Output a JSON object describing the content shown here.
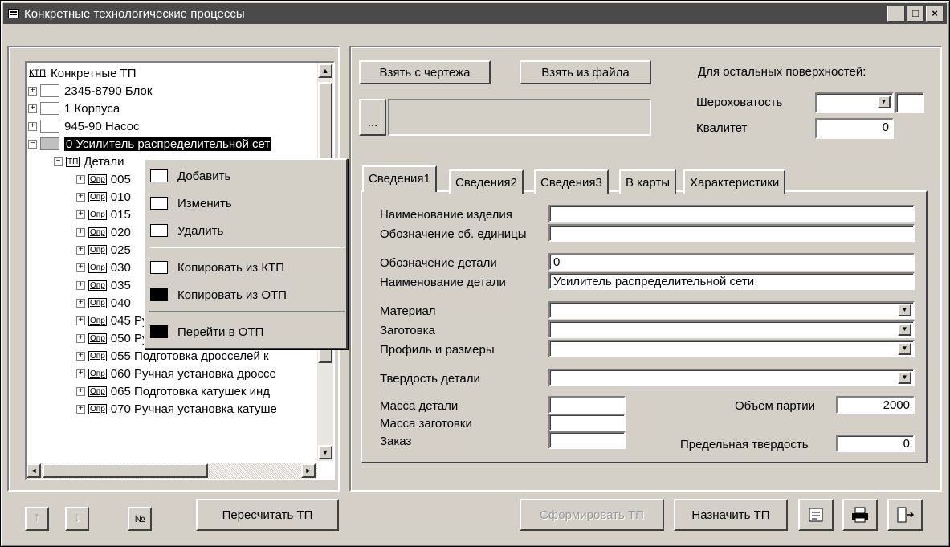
{
  "window": {
    "title": "Конкретные технологические процессы",
    "minimize": "_",
    "maximize": "□",
    "close": "×"
  },
  "tree": {
    "root_tag": "КТП",
    "root_label": "Конкретные ТП",
    "items": [
      {
        "label": "2345-8790 Блок"
      },
      {
        "label": "1 Корпуса"
      },
      {
        "label": "945-90 Насос"
      },
      {
        "label": "0 Усилитель распределительной сет"
      }
    ],
    "sub_tag": "ТП",
    "sub_label": "Детали",
    "op_tag": "Опр",
    "ops": [
      {
        "label": "005"
      },
      {
        "label": "010"
      },
      {
        "label": "015"
      },
      {
        "label": "020"
      },
      {
        "label": "025"
      },
      {
        "label": "030"
      },
      {
        "label": "035"
      },
      {
        "label": "040"
      },
      {
        "label": "045  Ручная установка конден"
      },
      {
        "label": "050  Ручная установка аттенк"
      },
      {
        "label": "055  Подготовка дросселей к"
      },
      {
        "label": "060  Ручная установка дроссе"
      },
      {
        "label": "065  Подготовка катушек инд"
      },
      {
        "label": "070  Ручная установка катуше"
      }
    ]
  },
  "context_menu": {
    "items": [
      "Добавить",
      "Изменить",
      "Удалить",
      "Копировать из КТП",
      "Копировать из ОТП",
      "Перейти в ОТП"
    ]
  },
  "top": {
    "btn_drawing": "Взять с чертежа",
    "btn_file": "Взять из файла",
    "ellipsis": "...",
    "other_surfaces": "Для остальных поверхностей:",
    "roughness_label": "Шероховатость",
    "quality_label": "Квалитет",
    "quality_value": "0"
  },
  "tabs": [
    "Сведения1",
    "Сведения2",
    "Сведения3",
    "В карты",
    "Характеристики"
  ],
  "form": {
    "product_name_label": "Наименование изделия",
    "assembly_label": "Обозначение сб. единицы",
    "part_code_label": "Обозначение детали",
    "part_code_value": "0",
    "part_name_label": "Наименование детали",
    "part_name_value": "Усилитель распределительной сети",
    "material_label": "Материал",
    "blank_label": "Заготовка",
    "profile_label": "Профиль и размеры",
    "hardness_label": "Твердость детали",
    "part_mass_label": "Масса детали",
    "blank_mass_label": "Масса заготовки",
    "order_label": "Заказ",
    "batch_label": "Объем партии",
    "batch_value": "2000",
    "limit_hardness_label": "Предельная твердость",
    "limit_hardness_value": "0"
  },
  "bottom": {
    "up": "↑",
    "down": "↓",
    "number": "№",
    "recalc": "Пересчитать ТП",
    "form_tp": "Сформировать ТП",
    "assign_tp": "Назначить ТП"
  }
}
